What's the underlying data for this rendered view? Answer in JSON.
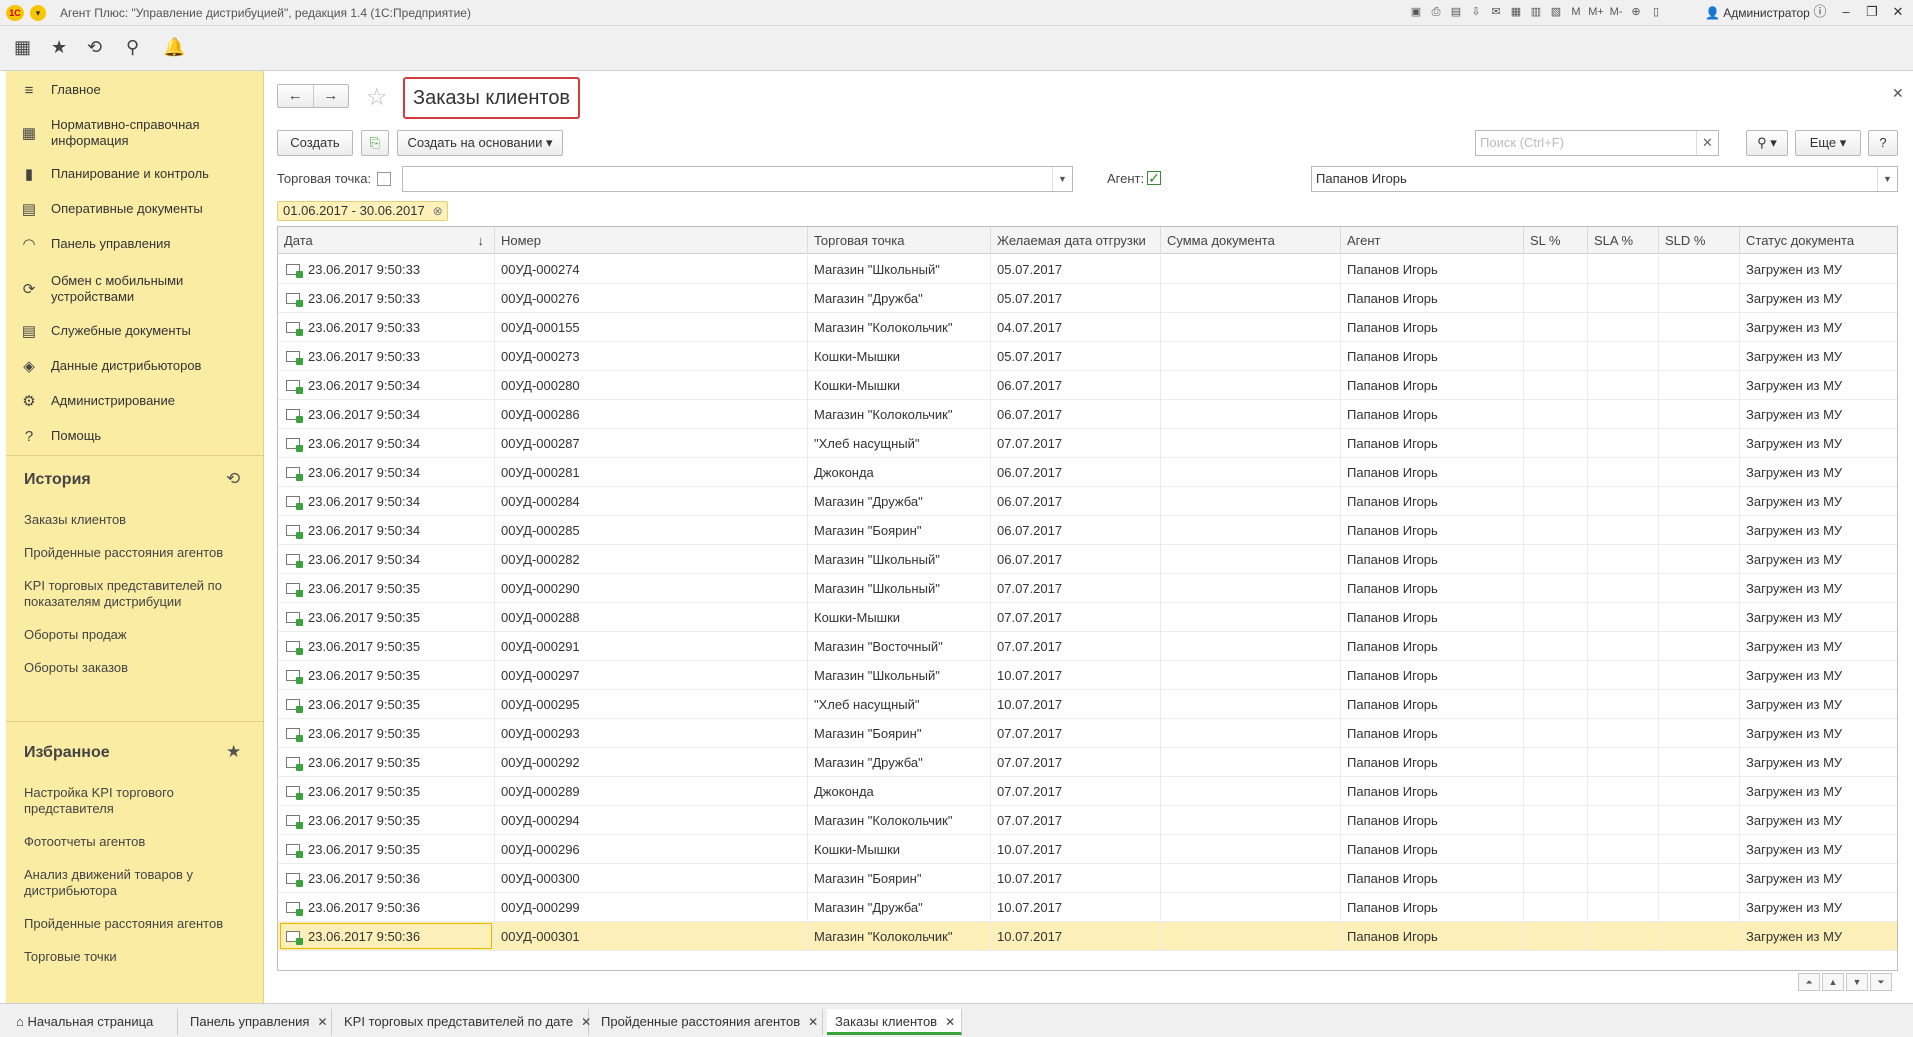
{
  "window": {
    "title": "Агент Плюс: \"Управление дистрибуцией\", редакция 1.4  (1С:Предприятие)",
    "user": "Администратор",
    "logo_text": "1С"
  },
  "sidebar": {
    "items": [
      {
        "label": "Главное",
        "icon": "menu-icon"
      },
      {
        "label": "Нормативно-справочная информация",
        "icon": "grid-icon"
      },
      {
        "label": "Планирование и контроль",
        "icon": "bar-chart-icon"
      },
      {
        "label": "Оперативные документы",
        "icon": "document-icon"
      },
      {
        "label": "Панель управления",
        "icon": "gauge-icon"
      },
      {
        "label": "Обмен с мобильными устройствами",
        "icon": "sync-icon"
      },
      {
        "label": "Служебные документы",
        "icon": "document-icon"
      },
      {
        "label": "Данные дистрибьюторов",
        "icon": "data-icon"
      },
      {
        "label": "Администрирование",
        "icon": "gear-icon"
      },
      {
        "label": "Помощь",
        "icon": "help-icon"
      }
    ],
    "history_title": "История",
    "history": [
      "Заказы клиентов",
      "Пройденные расстояния агентов",
      "KPI торговых представителей по показателям дистрибуции",
      "Обороты продаж",
      "Обороты заказов"
    ],
    "favorites_title": "Избранное",
    "favorites": [
      "Настройка KPI торгового представителя",
      "Фотоотчеты агентов",
      "Анализ движений товаров у дистрибьютора",
      "Пройденные расстояния агентов",
      "Торговые точки"
    ]
  },
  "form": {
    "title": "Заказы клиентов",
    "create_label": "Создать",
    "create_based_label": "Создать на основании",
    "search_placeholder": "Поиск (Ctrl+F)",
    "more_label": "Еще",
    "help_label": "?",
    "outlet_label": "Торговая точка:",
    "outlet_value": "",
    "agent_label": "Агент:",
    "agent_value": "Папанов Игорь",
    "period": "01.06.2017 - 30.06.2017"
  },
  "table": {
    "columns": [
      "Дата",
      "Номер",
      "Торговая точка",
      "Желаемая дата отгрузки",
      "Сумма документа",
      "Агент",
      "SL %",
      "SLA %",
      "SLD %",
      "Статус документа"
    ],
    "rows": [
      [
        "23.06.2017 9:50:33",
        "00УД-000274",
        "Магазин \"Школьный\"",
        "05.07.2017",
        "",
        "Папанов Игорь",
        "",
        "",
        "",
        "Загружен из МУ"
      ],
      [
        "23.06.2017 9:50:33",
        "00УД-000276",
        "Магазин \"Дружба\"",
        "05.07.2017",
        "",
        "Папанов Игорь",
        "",
        "",
        "",
        "Загружен из МУ"
      ],
      [
        "23.06.2017 9:50:33",
        "00УД-000155",
        "Магазин \"Колокольчик\"",
        "04.07.2017",
        "",
        "Папанов Игорь",
        "",
        "",
        "",
        "Загружен из МУ"
      ],
      [
        "23.06.2017 9:50:33",
        "00УД-000273",
        "Кошки-Мышки",
        "05.07.2017",
        "",
        "Папанов Игорь",
        "",
        "",
        "",
        "Загружен из МУ"
      ],
      [
        "23.06.2017 9:50:34",
        "00УД-000280",
        "Кошки-Мышки",
        "06.07.2017",
        "",
        "Папанов Игорь",
        "",
        "",
        "",
        "Загружен из МУ"
      ],
      [
        "23.06.2017 9:50:34",
        "00УД-000286",
        "Магазин \"Колокольчик\"",
        "06.07.2017",
        "",
        "Папанов Игорь",
        "",
        "",
        "",
        "Загружен из МУ"
      ],
      [
        "23.06.2017 9:50:34",
        "00УД-000287",
        "\"Хлеб насущный\"",
        "07.07.2017",
        "",
        "Папанов Игорь",
        "",
        "",
        "",
        "Загружен из МУ"
      ],
      [
        "23.06.2017 9:50:34",
        "00УД-000281",
        "Джоконда",
        "06.07.2017",
        "",
        "Папанов Игорь",
        "",
        "",
        "",
        "Загружен из МУ"
      ],
      [
        "23.06.2017 9:50:34",
        "00УД-000284",
        "Магазин \"Дружба\"",
        "06.07.2017",
        "",
        "Папанов Игорь",
        "",
        "",
        "",
        "Загружен из МУ"
      ],
      [
        "23.06.2017 9:50:34",
        "00УД-000285",
        "Магазин \"Боярин\"",
        "06.07.2017",
        "",
        "Папанов Игорь",
        "",
        "",
        "",
        "Загружен из МУ"
      ],
      [
        "23.06.2017 9:50:34",
        "00УД-000282",
        "Магазин \"Школьный\"",
        "06.07.2017",
        "",
        "Папанов Игорь",
        "",
        "",
        "",
        "Загружен из МУ"
      ],
      [
        "23.06.2017 9:50:35",
        "00УД-000290",
        "Магазин \"Школьный\"",
        "07.07.2017",
        "",
        "Папанов Игорь",
        "",
        "",
        "",
        "Загружен из МУ"
      ],
      [
        "23.06.2017 9:50:35",
        "00УД-000288",
        "Кошки-Мышки",
        "07.07.2017",
        "",
        "Папанов Игорь",
        "",
        "",
        "",
        "Загружен из МУ"
      ],
      [
        "23.06.2017 9:50:35",
        "00УД-000291",
        "Магазин \"Восточный\"",
        "07.07.2017",
        "",
        "Папанов Игорь",
        "",
        "",
        "",
        "Загружен из МУ"
      ],
      [
        "23.06.2017 9:50:35",
        "00УД-000297",
        "Магазин \"Школьный\"",
        "10.07.2017",
        "",
        "Папанов Игорь",
        "",
        "",
        "",
        "Загружен из МУ"
      ],
      [
        "23.06.2017 9:50:35",
        "00УД-000295",
        "\"Хлеб насущный\"",
        "10.07.2017",
        "",
        "Папанов Игорь",
        "",
        "",
        "",
        "Загружен из МУ"
      ],
      [
        "23.06.2017 9:50:35",
        "00УД-000293",
        "Магазин \"Боярин\"",
        "07.07.2017",
        "",
        "Папанов Игорь",
        "",
        "",
        "",
        "Загружен из МУ"
      ],
      [
        "23.06.2017 9:50:35",
        "00УД-000292",
        "Магазин \"Дружба\"",
        "07.07.2017",
        "",
        "Папанов Игорь",
        "",
        "",
        "",
        "Загружен из МУ"
      ],
      [
        "23.06.2017 9:50:35",
        "00УД-000289",
        "Джоконда",
        "07.07.2017",
        "",
        "Папанов Игорь",
        "",
        "",
        "",
        "Загружен из МУ"
      ],
      [
        "23.06.2017 9:50:35",
        "00УД-000294",
        "Магазин \"Колокольчик\"",
        "07.07.2017",
        "",
        "Папанов Игорь",
        "",
        "",
        "",
        "Загружен из МУ"
      ],
      [
        "23.06.2017 9:50:35",
        "00УД-000296",
        "Кошки-Мышки",
        "10.07.2017",
        "",
        "Папанов Игорь",
        "",
        "",
        "",
        "Загружен из МУ"
      ],
      [
        "23.06.2017 9:50:36",
        "00УД-000300",
        "Магазин \"Боярин\"",
        "10.07.2017",
        "",
        "Папанов Игорь",
        "",
        "",
        "",
        "Загружен из МУ"
      ],
      [
        "23.06.2017 9:50:36",
        "00УД-000299",
        "Магазин \"Дружба\"",
        "10.07.2017",
        "",
        "Папанов Игорь",
        "",
        "",
        "",
        "Загружен из МУ"
      ],
      [
        "23.06.2017 9:50:36",
        "00УД-000301",
        "Магазин \"Колокольчик\"",
        "10.07.2017",
        "",
        "Папанов Игорь",
        "",
        "",
        "",
        "Загружен из МУ"
      ]
    ],
    "selected_row": 23
  },
  "taskbar": {
    "tabs": [
      "Начальная страница",
      "Панель управления",
      "KPI торговых представителей по дате",
      "Пройденные расстояния агентов",
      "Заказы клиентов"
    ],
    "active": 4
  },
  "colors": {
    "sidebar_bg": "#fbeca4",
    "highlight_border": "#d43c3c",
    "selected_row": "#fcf0b8",
    "accent_green": "#3ba33b"
  }
}
